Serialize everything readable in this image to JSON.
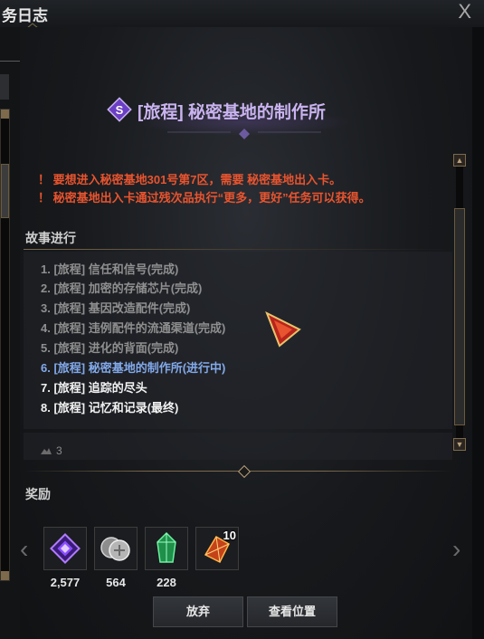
{
  "window": {
    "title": "务日志",
    "close_label": "X"
  },
  "quest": {
    "title": "[旅程] 秘密基地的制作所",
    "warnings": [
      "！ 要想进入秘密基地301号第7区，需要 秘密基地出入卡。",
      "！  秘密基地出入卡通过残次品执行“更多，更好”任务可以获得。"
    ]
  },
  "story": {
    "label": "故事进行",
    "steps": [
      {
        "text": "1. [旅程] 信任和信号(完成)",
        "state": "done"
      },
      {
        "text": "2. [旅程] 加密的存储芯片(完成)",
        "state": "done"
      },
      {
        "text": "3. [旅程] 基因改造配件(完成)",
        "state": "done"
      },
      {
        "text": "4. [旅程] 违例配件的流通渠道(完成)",
        "state": "done"
      },
      {
        "text": "5. [旅程] 进化的背面(完成)",
        "state": "done"
      },
      {
        "text": "6. [旅程] 秘密基地的制作所(进行中)",
        "state": "current"
      },
      {
        "text": "7. [旅程] 追踪的尽头",
        "state": "todo"
      },
      {
        "text": "8. [旅程] 记忆和记录(最终)",
        "state": "todo"
      }
    ],
    "count": "3"
  },
  "rewards": {
    "label": "奖励",
    "items": [
      {
        "icon": "purple-emblem-icon",
        "qty": "2,577"
      },
      {
        "icon": "silver-coins-icon",
        "qty": "564"
      },
      {
        "icon": "green-crystal-icon",
        "qty": "228"
      },
      {
        "icon": "orange-crystal-icon",
        "badge": "10"
      }
    ]
  },
  "buttons": {
    "abandon": "放弃",
    "view_location": "查看位置"
  },
  "colors": {
    "warning": "#e8542f",
    "current_step": "#82a9ea",
    "done_step": "#8f8f8f",
    "quest_title": "#c9b3f0",
    "accent_gold": "#7d6a4c"
  }
}
